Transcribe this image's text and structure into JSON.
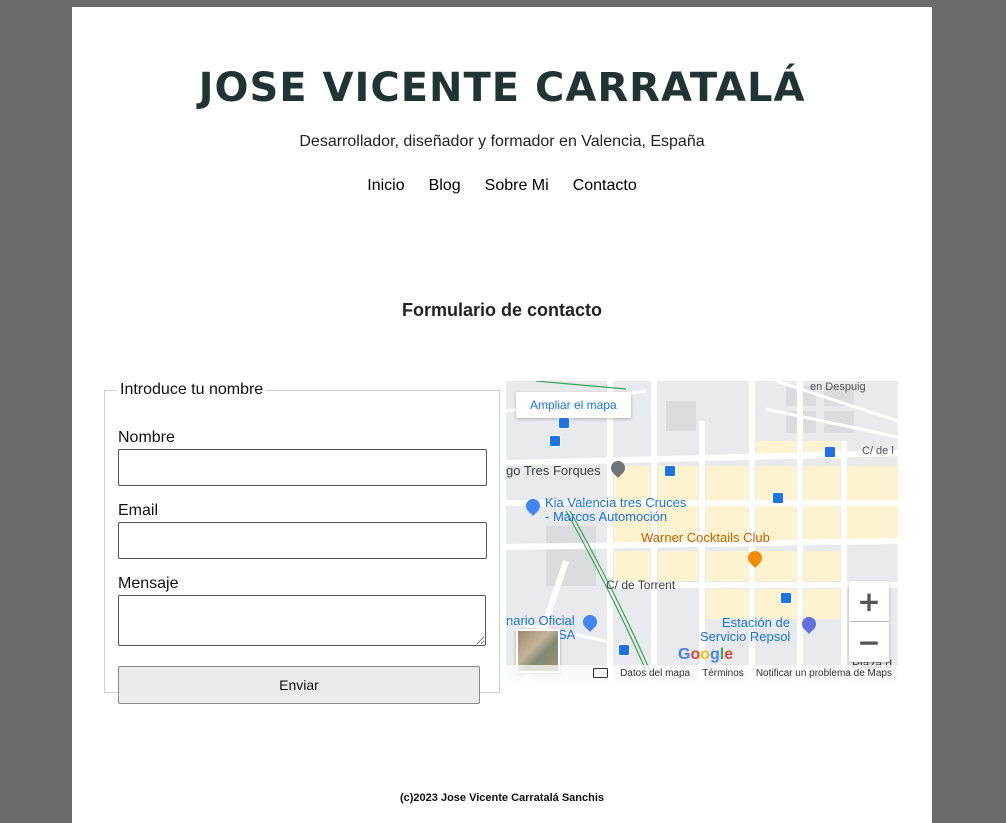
{
  "header": {
    "site_title": "JOSE VICENTE CARRATALÁ",
    "tagline": "Desarrollador, diseñador y formador en Valencia, España",
    "nav": [
      "Inicio",
      "Blog",
      "Sobre Mi",
      "Contacto"
    ]
  },
  "main": {
    "section_title": "Formulario de contacto",
    "form": {
      "legend": "Introduce tu nombre",
      "name_label": "Nombre",
      "name_value": "",
      "email_label": "Email",
      "email_value": "",
      "message_label": "Mensaje",
      "message_value": "",
      "submit_label": "Enviar"
    },
    "map": {
      "enlarge_link": "Ampliar el mapa",
      "labels": {
        "street_despuig": "en Despuig",
        "street_c_de": "C/ de l",
        "place_tres_forques": "go Tres Forques",
        "kia_line1": "Kia Valencia tres Cruces",
        "kia_line2": "- Marcos Automoción",
        "warner": "Warner Cocktails Club",
        "street_torrent": "C/ de Torrent",
        "oficial_line1": "nario Oficial",
        "oficial_line2": "SA",
        "repsol_line1": "Estación de",
        "repsol_line2": "Servicio Repsol",
        "plaza": "Plaza d"
      },
      "zoom_in": "+",
      "zoom_out": "−",
      "google_logo": "Google",
      "footer_links": [
        "Datos del mapa",
        "Términos",
        "Notificar un problema de Maps"
      ],
      "icons": [
        "keyboard-icon",
        "bus-stop-icon",
        "place-pin-icon",
        "shopping-pin-icon",
        "cocktail-pin-icon",
        "gas-station-pin-icon"
      ]
    }
  },
  "footer": {
    "copyright": "(c)2023 Jose Vicente Carratalá Sanchis"
  }
}
